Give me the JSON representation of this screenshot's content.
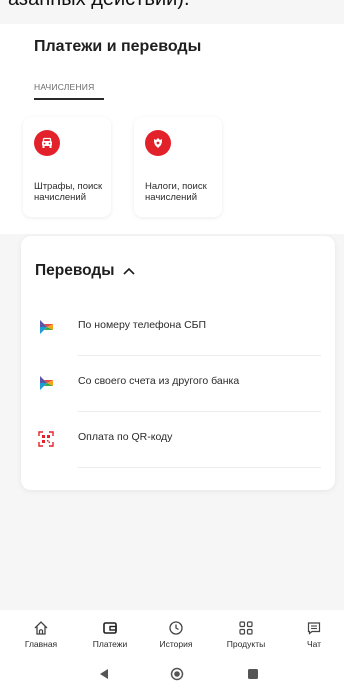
{
  "top_snippet": "азанных действий).",
  "page": {
    "title": "Платежи и переводы",
    "tab_label": "НАЧИСЛЕНИЯ"
  },
  "tiles": [
    {
      "label": "Штрафы, поиск начислений",
      "icon": "car-icon"
    },
    {
      "label": "Налоги, поиск начислений",
      "icon": "emblem-icon"
    }
  ],
  "transfers": {
    "title": "Переводы",
    "items": [
      {
        "label": "По номеру телефона СБП",
        "icon": "sbp-icon"
      },
      {
        "label": "Со своего счета из другого банка",
        "icon": "sbp-icon"
      },
      {
        "label": "Оплата по QR-коду",
        "icon": "qr-icon"
      }
    ]
  },
  "nav": [
    {
      "label": "Главная",
      "icon": "home-icon"
    },
    {
      "label": "Платежи",
      "icon": "wallet-icon"
    },
    {
      "label": "История",
      "icon": "clock-icon"
    },
    {
      "label": "Продукты",
      "icon": "grid-icon"
    },
    {
      "label": "Чат",
      "icon": "chat-icon"
    }
  ],
  "colors": {
    "accent": "#e3212b",
    "text": "#1f1f1f"
  }
}
